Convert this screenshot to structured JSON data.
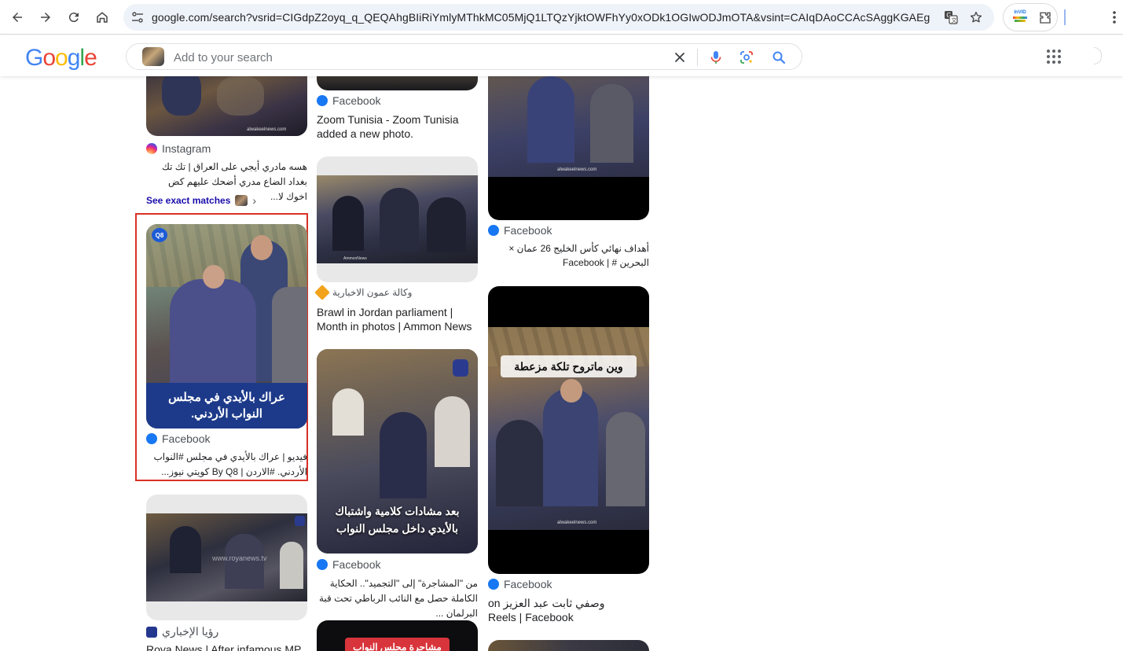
{
  "browser": {
    "url": "google.com/search?vsrid=CIGdpZ2oyq_q_QEQAhgBIiRiYmlyMThkMC05MjQ1LTQzYjktOWFhYy0xODk1OGIwODJmOTA&vsint=CAIqDAoCCAcSAggKGAEgATojCh...",
    "extension_label": "InVID"
  },
  "google": {
    "logo_letters": [
      "G",
      "o",
      "o",
      "g",
      "l",
      "e"
    ],
    "logo_colors": [
      "#4285F4",
      "#EA4335",
      "#FBBC05",
      "#4285F4",
      "#34A853",
      "#EA4335"
    ],
    "search_placeholder": "Add to your search"
  },
  "results": {
    "col1": {
      "card_a": {
        "source": "Instagram",
        "title": "هسه مادري أيجي على العراق | تك تك بغداد الضاع مدري أضحك عليهم كض اخوك لا...",
        "watermark": "alwakeelnews.com",
        "see_exact": "See exact matches"
      },
      "card_b": {
        "badge": "Q8",
        "caption": "عراك بالأيدي في مجلس النواب الأردني.",
        "source": "Facebook",
        "title": "فيديو | عراك بالأيدي في مجلس #النواب الأردني. #الاردن | By Q8 كويتي نيوز..."
      },
      "card_c": {
        "watermark": "www.royanews.tv",
        "source": "رؤيا الإخباري",
        "title": "Roya News | After infamous MP"
      }
    },
    "col2": {
      "card_a": {
        "source": "Facebook",
        "title": "Zoom Tunisia - Zoom Tunisia added a new photo."
      },
      "card_b": {
        "watermark": "AmmonNews",
        "source": "وكالة عمون الاخبارية",
        "title": "Brawl in Jordan parliament | Month in photos | Ammon News"
      },
      "card_c": {
        "caption": "بعد مشادات كلامية واشتباك بالأيدي داخل مجلس النواب",
        "source": "Facebook",
        "title": "من \"المشاجرة\" إلى \"التجميد\".. الحكاية الكاملة حصل مع النائب الرباطي تحت قبة البرلمان ..."
      },
      "card_d": {
        "caption": "مشاجرة مجلس النواب"
      }
    },
    "col3": {
      "card_a": {
        "watermark": "alwakeelnews.com",
        "source": "Facebook",
        "title": "أهداف نهائي كأس الخليج 26 عمان × البحرين # | Facebook"
      },
      "card_b": {
        "caption": "وين ماتروح تلكة مزعطة",
        "watermark": "alwakeelnews.com",
        "source": "Facebook",
        "title": "وصفي ثابت عبد العزيز on Reels | Facebook"
      }
    }
  }
}
